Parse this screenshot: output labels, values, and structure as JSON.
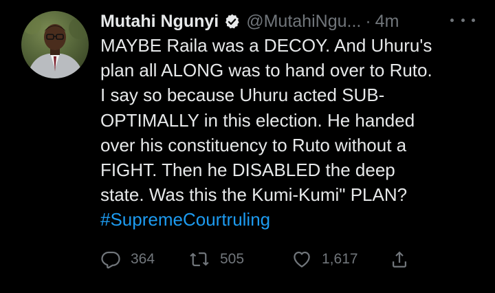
{
  "tweet": {
    "author": {
      "display_name": "Mutahi Ngunyi",
      "handle": "@MutahiNgu...",
      "verified": true,
      "avatar_icon": "profile-photo"
    },
    "separator": "·",
    "timestamp": "4m",
    "more_icon": "more-icon",
    "text_lines": [
      "MAYBE Raila was a DECOY. And Uhuru's",
      "plan all ALONG was to hand over to Ruto.",
      "I say so because Uhuru acted SUB-",
      "OPTIMALLY in this election. He handed",
      "over his constituency to Ruto without a",
      "FIGHT. Then he DISABLED the deep",
      "state. Was this the Kumi-Kumi\" PLAN?"
    ],
    "hashtag": "#SupremeCourtruling",
    "actions": {
      "reply": {
        "icon": "reply-icon",
        "count": "364"
      },
      "retweet": {
        "icon": "retweet-icon",
        "count": "505"
      },
      "like": {
        "icon": "like-icon",
        "count": "1,617"
      },
      "share": {
        "icon": "share-icon"
      }
    }
  },
  "colors": {
    "background": "#000000",
    "primary_text": "#e7e9ea",
    "secondary_text": "#71767b",
    "accent": "#1d9bf0"
  }
}
